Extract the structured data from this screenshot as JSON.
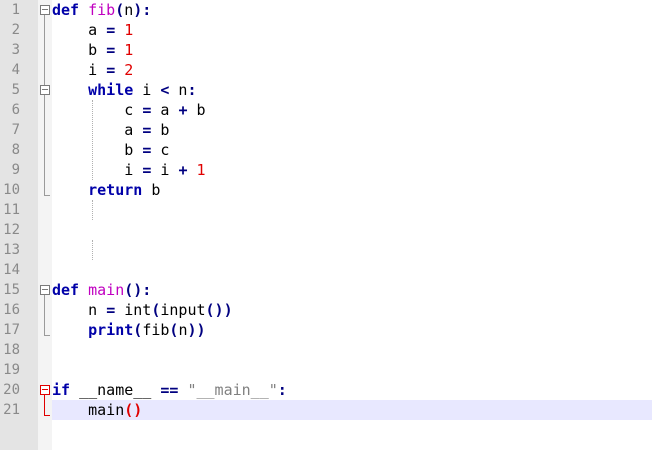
{
  "editor": {
    "language": "python",
    "current_line": 21,
    "line_numbers": [
      "1",
      "2",
      "3",
      "4",
      "5",
      "6",
      "7",
      "8",
      "9",
      "10",
      "11",
      "12",
      "13",
      "14",
      "15",
      "16",
      "17",
      "18",
      "19",
      "20",
      "21"
    ],
    "lines": [
      {
        "tokens": [
          {
            "t": "def",
            "c": "kw"
          },
          {
            "t": " ",
            "c": "plain"
          },
          {
            "t": "fib",
            "c": "fn"
          },
          {
            "t": "(",
            "c": "paren"
          },
          {
            "t": "n",
            "c": "plain"
          },
          {
            "t": "):",
            "c": "paren"
          }
        ]
      },
      {
        "tokens": [
          {
            "t": "    a ",
            "c": "plain"
          },
          {
            "t": "=",
            "c": "op"
          },
          {
            "t": " ",
            "c": "plain"
          },
          {
            "t": "1",
            "c": "num"
          }
        ]
      },
      {
        "tokens": [
          {
            "t": "    b ",
            "c": "plain"
          },
          {
            "t": "=",
            "c": "op"
          },
          {
            "t": " ",
            "c": "plain"
          },
          {
            "t": "1",
            "c": "num"
          }
        ]
      },
      {
        "tokens": [
          {
            "t": "    i ",
            "c": "plain"
          },
          {
            "t": "=",
            "c": "op"
          },
          {
            "t": " ",
            "c": "plain"
          },
          {
            "t": "2",
            "c": "num"
          }
        ]
      },
      {
        "tokens": [
          {
            "t": "    ",
            "c": "plain"
          },
          {
            "t": "while",
            "c": "kw"
          },
          {
            "t": " i ",
            "c": "plain"
          },
          {
            "t": "<",
            "c": "op"
          },
          {
            "t": " n",
            "c": "plain"
          },
          {
            "t": ":",
            "c": "op"
          }
        ]
      },
      {
        "tokens": [
          {
            "t": "        c ",
            "c": "plain"
          },
          {
            "t": "=",
            "c": "op"
          },
          {
            "t": " a ",
            "c": "plain"
          },
          {
            "t": "+",
            "c": "op"
          },
          {
            "t": " b",
            "c": "plain"
          }
        ]
      },
      {
        "tokens": [
          {
            "t": "        a ",
            "c": "plain"
          },
          {
            "t": "=",
            "c": "op"
          },
          {
            "t": " b",
            "c": "plain"
          }
        ]
      },
      {
        "tokens": [
          {
            "t": "        b ",
            "c": "plain"
          },
          {
            "t": "=",
            "c": "op"
          },
          {
            "t": " c",
            "c": "plain"
          }
        ]
      },
      {
        "tokens": [
          {
            "t": "        i ",
            "c": "plain"
          },
          {
            "t": "=",
            "c": "op"
          },
          {
            "t": " i ",
            "c": "plain"
          },
          {
            "t": "+",
            "c": "op"
          },
          {
            "t": " ",
            "c": "plain"
          },
          {
            "t": "1",
            "c": "num"
          }
        ]
      },
      {
        "tokens": [
          {
            "t": "    ",
            "c": "plain"
          },
          {
            "t": "return",
            "c": "kw"
          },
          {
            "t": " b",
            "c": "plain"
          }
        ]
      },
      {
        "tokens": []
      },
      {
        "tokens": []
      },
      {
        "tokens": []
      },
      {
        "tokens": []
      },
      {
        "tokens": [
          {
            "t": "def",
            "c": "kw"
          },
          {
            "t": " ",
            "c": "plain"
          },
          {
            "t": "main",
            "c": "fn"
          },
          {
            "t": "():",
            "c": "paren"
          }
        ]
      },
      {
        "tokens": [
          {
            "t": "    n ",
            "c": "plain"
          },
          {
            "t": "=",
            "c": "op"
          },
          {
            "t": " int",
            "c": "plain"
          },
          {
            "t": "(",
            "c": "paren"
          },
          {
            "t": "input",
            "c": "plain"
          },
          {
            "t": "())",
            "c": "paren"
          }
        ]
      },
      {
        "tokens": [
          {
            "t": "    ",
            "c": "plain"
          },
          {
            "t": "print",
            "c": "kw"
          },
          {
            "t": "(",
            "c": "paren"
          },
          {
            "t": "fib",
            "c": "plain"
          },
          {
            "t": "(",
            "c": "paren"
          },
          {
            "t": "n",
            "c": "plain"
          },
          {
            "t": "))",
            "c": "paren"
          }
        ]
      },
      {
        "tokens": []
      },
      {
        "tokens": []
      },
      {
        "tokens": [
          {
            "t": "if",
            "c": "kw"
          },
          {
            "t": " __name__ ",
            "c": "plain"
          },
          {
            "t": "==",
            "c": "op"
          },
          {
            "t": " ",
            "c": "plain"
          },
          {
            "t": "\"__main__\"",
            "c": "str"
          },
          {
            "t": ":",
            "c": "op"
          }
        ]
      },
      {
        "tokens": [
          {
            "t": "    main",
            "c": "plain"
          },
          {
            "t": "()",
            "c": "paren-red"
          }
        ]
      }
    ]
  },
  "colors": {
    "keyword": "#0000a8",
    "function_name": "#c000c0",
    "number": "#e00000",
    "string": "#808080",
    "current_line_bg": "#e8e8ff",
    "gutter_bg": "#e4e4e4"
  }
}
